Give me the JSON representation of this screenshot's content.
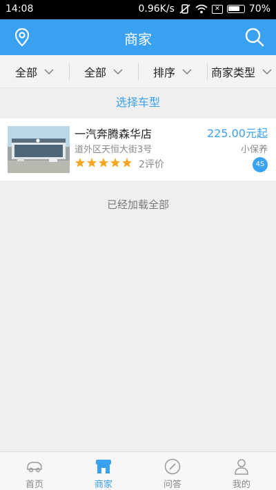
{
  "status_bar": {
    "time": "14:08",
    "speed": "0.96K/s",
    "battery": "70%"
  },
  "header": {
    "title": "商家"
  },
  "filters": [
    {
      "label": "全部"
    },
    {
      "label": "全部"
    },
    {
      "label": "排序"
    },
    {
      "label": "商家类型"
    }
  ],
  "car_type_label": "选择车型",
  "merchants": [
    {
      "name": "一汽奔腾森华店",
      "address": "道外区天恒大街3号",
      "price": "225.00元起",
      "service": "小保养",
      "rating": 5,
      "reviews": "2评价",
      "badge": "4S"
    }
  ],
  "loaded_text": "已经加载全部",
  "tabs": [
    {
      "label": "首页",
      "icon": "car-icon"
    },
    {
      "label": "商家",
      "icon": "store-icon"
    },
    {
      "label": "问答",
      "icon": "compass-icon"
    },
    {
      "label": "我的",
      "icon": "user-icon"
    }
  ],
  "colors": {
    "accent": "#3aa0f0",
    "star": "#f5a623"
  }
}
